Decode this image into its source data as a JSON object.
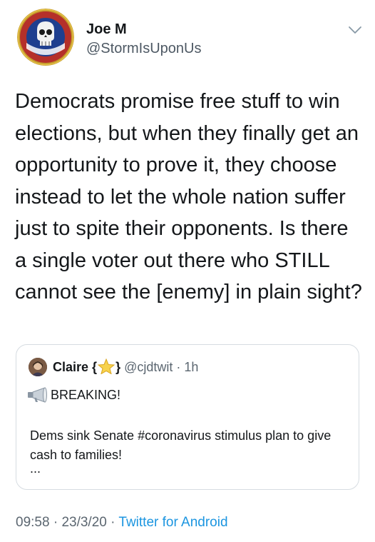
{
  "tweet": {
    "author_name": "Joe M",
    "author_handle": "@StormIsUponUs",
    "text": "Democrats promise free stuff to win elections, but when they finally get an opportunity to prove it, they choose instead to let the whole nation suffer just to spite their opponents. Is there a single voter out there who STILL cannot see the [enemy] in plain sight?",
    "time": "09:58",
    "date": "23/3/20",
    "separator": "·",
    "source": "Twitter for Android"
  },
  "quoted": {
    "name": "Claire",
    "brace_open": "{",
    "brace_close": "}",
    "handle": "@cjdtwit",
    "separator": "·",
    "time": "1h",
    "breaking": "BREAKING!",
    "text": "Dems sink Senate #coronavirus stimulus plan to give cash to families!",
    "ellipsis": "..."
  },
  "icons": {
    "caret": "chevron-down-icon",
    "star": "star-emoji-icon",
    "megaphone": "megaphone-emoji-icon"
  },
  "colors": {
    "text": "#14171a",
    "secondary": "#5b6670",
    "link": "#1b95e0",
    "border": "#d6dce1"
  }
}
